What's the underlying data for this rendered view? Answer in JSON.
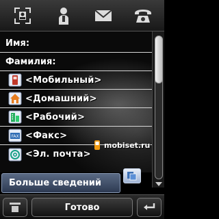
{
  "top_tabs": [
    {
      "name": "scan",
      "icon": "scan-icon"
    },
    {
      "name": "contacts",
      "icon": "contacts-icon"
    },
    {
      "name": "messages",
      "icon": "envelope-icon"
    },
    {
      "name": "calls",
      "icon": "phone-icon"
    }
  ],
  "form": {
    "name_label": "Имя:",
    "surname_label": "Фамилия:",
    "fields": [
      {
        "icon": "mobile-phone-icon",
        "text": "<Мобильный>"
      },
      {
        "icon": "home-icon",
        "text": "<Домашний>"
      },
      {
        "icon": "office-building-icon",
        "text": "<Рабочий>"
      },
      {
        "icon": "fax-icon",
        "text": "<Факс>"
      },
      {
        "icon": "email-at-icon",
        "text": "<Эл. почта>"
      }
    ]
  },
  "watermark": {
    "text": "mobiset.ru"
  },
  "more_button": {
    "label": "Больше сведений"
  },
  "softkeys": {
    "left_icon": "menu-icon",
    "center_label": "Готово",
    "right_icon": "back-arrow-icon"
  },
  "colors": {
    "accent": "#5a6a84",
    "background": "#0a0a0a",
    "text": "#ffffff"
  }
}
